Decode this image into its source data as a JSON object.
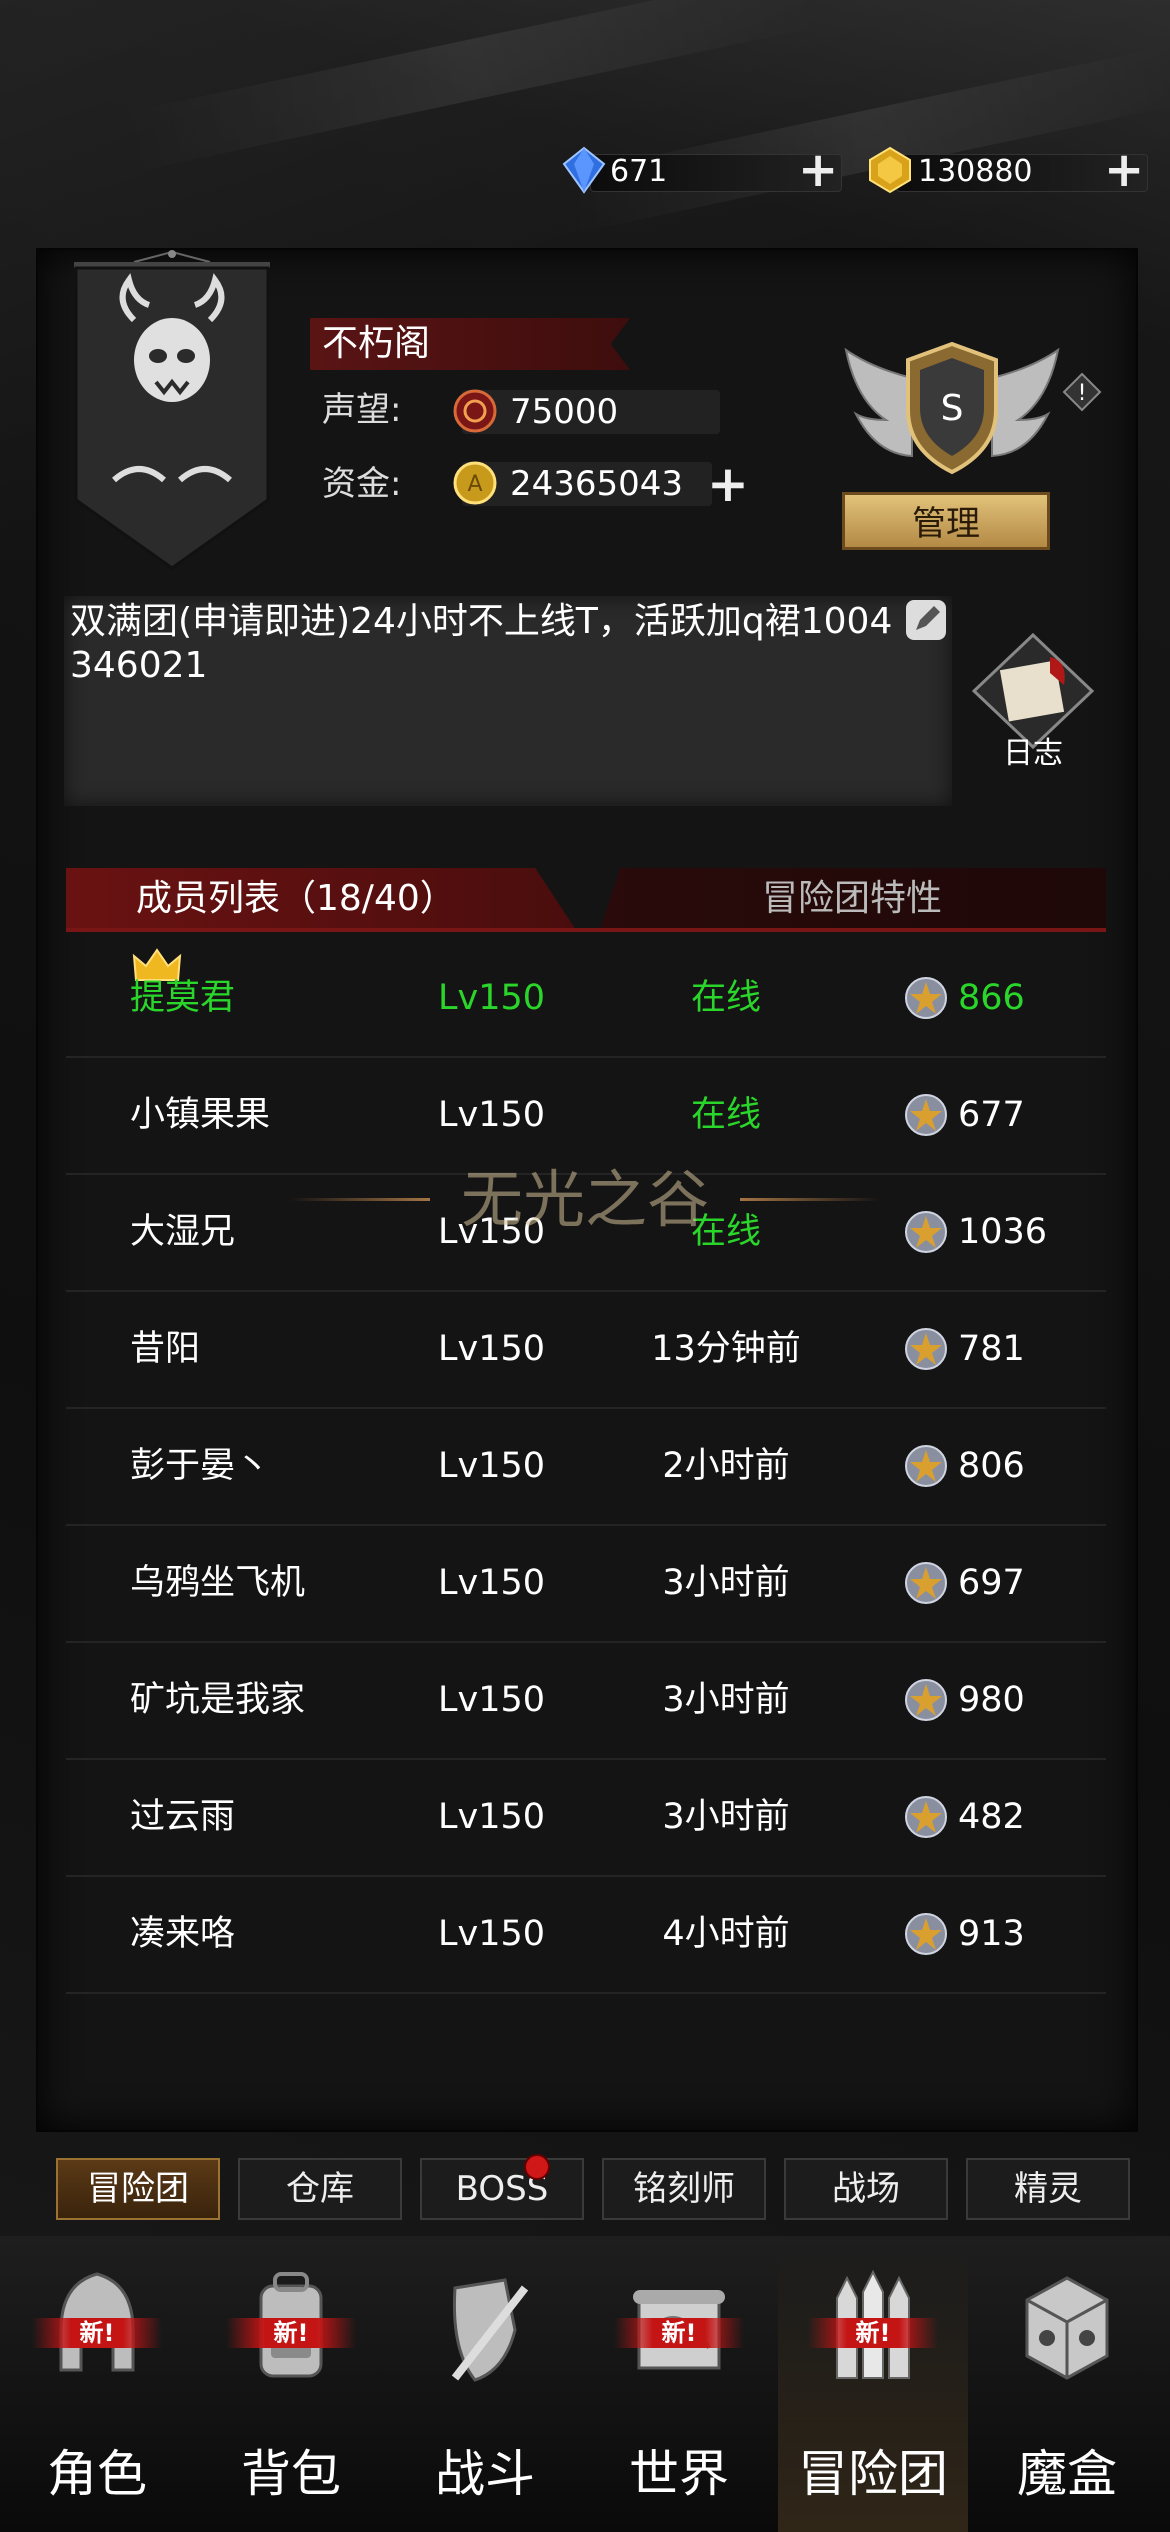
{
  "currency": {
    "diamonds": "671",
    "gold": "130880"
  },
  "guild": {
    "name": "不朽阁",
    "reputation_label": "声望:",
    "reputation": "75000",
    "funds_label": "资金:",
    "funds": "24365043",
    "rank": "S",
    "manage_label": "管理",
    "notice": "双满团(申请即进)24小时不上线T，活跃加q裙1004346021",
    "log_label": "日志"
  },
  "tabs": {
    "members": "成员列表（18/40）",
    "traits": "冒险团特性"
  },
  "members": [
    {
      "name": "提莫君",
      "level": "Lv150",
      "status": "在线",
      "points": "866",
      "leader": true
    },
    {
      "name": "小镇果果",
      "level": "Lv150",
      "status": "在线",
      "points": "677"
    },
    {
      "name": "大湿兄",
      "level": "Lv150",
      "status": "在线",
      "points": "1036"
    },
    {
      "name": "昔阳",
      "level": "Lv150",
      "status": "13分钟前",
      "points": "781"
    },
    {
      "name": "彭于晏丶",
      "level": "Lv150",
      "status": "2小时前",
      "points": "806"
    },
    {
      "name": "乌鸦坐飞机",
      "level": "Lv150",
      "status": "3小时前",
      "points": "697"
    },
    {
      "name": "矿坑是我家",
      "level": "Lv150",
      "status": "3小时前",
      "points": "980"
    },
    {
      "name": "过云雨",
      "level": "Lv150",
      "status": "3小时前",
      "points": "482"
    },
    {
      "name": "凑来咯",
      "level": "Lv150",
      "status": "4小时前",
      "points": "913"
    }
  ],
  "watermark": "无光之谷",
  "subnav": [
    "冒险团",
    "仓库",
    "BOSS",
    "铭刻师",
    "战场",
    "精灵"
  ],
  "bottom_nav": [
    {
      "label": "角色",
      "badge": "新!"
    },
    {
      "label": "背包",
      "badge": "新!"
    },
    {
      "label": "战斗",
      "badge": ""
    },
    {
      "label": "世界",
      "badge": "新!"
    },
    {
      "label": "冒险团",
      "badge": "新!"
    },
    {
      "label": "魔盒",
      "badge": ""
    }
  ],
  "colors": {
    "online": "#2bd62b",
    "accent_red": "#6a1212",
    "gold": "#e2c27a"
  }
}
